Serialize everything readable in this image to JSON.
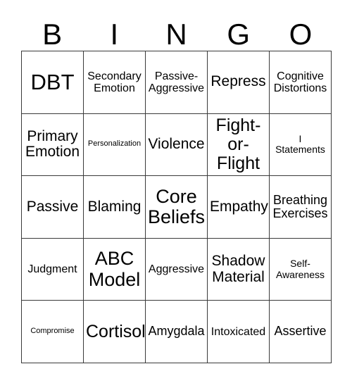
{
  "card": {
    "title": "BINGO Card",
    "header_letters": [
      "B",
      "I",
      "N",
      "G",
      "O"
    ],
    "colors": {
      "background": "#ffffff",
      "text": "#000000",
      "border": "#3a3a3a"
    },
    "grid": {
      "columns": 5,
      "rows": 5
    },
    "cells": [
      {
        "text": "DBT",
        "size": "xxl"
      },
      {
        "text": "Secondary\nEmotion",
        "size": "xs"
      },
      {
        "text": "Passive-\nAggressive",
        "size": "xs"
      },
      {
        "text": "Repress",
        "size": "m"
      },
      {
        "text": "Cognitive\nDistortions",
        "size": "xs"
      },
      {
        "text": "Primary\nEmotion",
        "size": "m"
      },
      {
        "text": "Personalization",
        "size": "tiny"
      },
      {
        "text": "Violence",
        "size": "m"
      },
      {
        "text": "Fight-\nor-\nFlight",
        "size": "l"
      },
      {
        "text": "I\nStatements",
        "size": "xxs"
      },
      {
        "text": "Passive",
        "size": "m"
      },
      {
        "text": "Blaming",
        "size": "m"
      },
      {
        "text": "Core\nBeliefs",
        "size": "xl"
      },
      {
        "text": "Empathy",
        "size": "m"
      },
      {
        "text": "Breathing\nExercises",
        "size": "s"
      },
      {
        "text": "Judgment",
        "size": "xs"
      },
      {
        "text": "ABC\nModel",
        "size": "xl"
      },
      {
        "text": "Aggressive",
        "size": "xs"
      },
      {
        "text": "Shadow\nMaterial",
        "size": "m"
      },
      {
        "text": "Self-\nAwareness",
        "size": "xxs"
      },
      {
        "text": "Compromise",
        "size": "tiny"
      },
      {
        "text": "Cortisol",
        "size": "l"
      },
      {
        "text": "Amygdala",
        "size": "s"
      },
      {
        "text": "Intoxicated",
        "size": "xs"
      },
      {
        "text": "Assertive",
        "size": "s"
      }
    ]
  }
}
